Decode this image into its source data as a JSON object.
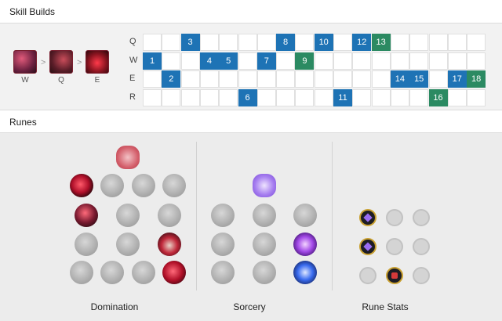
{
  "skill_section": {
    "title": "Skill Builds",
    "order": [
      {
        "key": "W",
        "icon": "skill-w-icon"
      },
      {
        "key": "Q",
        "icon": "skill-q-icon"
      },
      {
        "key": "E",
        "icon": "skill-e-icon"
      }
    ],
    "order_separator": ">",
    "rows": [
      {
        "key": "Q",
        "levels": [
          {
            "n": "3",
            "c": "blue"
          },
          {
            "n": "8",
            "c": "blue"
          },
          {
            "n": "10",
            "c": "blue"
          },
          {
            "n": "12",
            "c": "blue"
          },
          {
            "n": "13",
            "c": "green"
          }
        ]
      },
      {
        "key": "W",
        "levels": [
          {
            "n": "1",
            "c": "blue"
          },
          {
            "n": "4",
            "c": "blue"
          },
          {
            "n": "5",
            "c": "blue"
          },
          {
            "n": "7",
            "c": "blue"
          },
          {
            "n": "9",
            "c": "green"
          }
        ]
      },
      {
        "key": "E",
        "levels": [
          {
            "n": "2",
            "c": "blue"
          },
          {
            "n": "14",
            "c": "blue"
          },
          {
            "n": "15",
            "c": "blue"
          },
          {
            "n": "17",
            "c": "blue"
          },
          {
            "n": "18",
            "c": "green"
          }
        ]
      },
      {
        "key": "R",
        "levels": [
          {
            "n": "6",
            "c": "blue"
          },
          {
            "n": "11",
            "c": "blue"
          },
          {
            "n": "16",
            "c": "green"
          }
        ]
      }
    ],
    "colors": {
      "blue": "#1e73b5",
      "green": "#2b8a62"
    }
  },
  "runes_section": {
    "title": "Runes",
    "trees": [
      {
        "label": "Domination",
        "icon": "domination-tree-icon",
        "accent": "#c8283a"
      },
      {
        "label": "Sorcery",
        "icon": "sorcery-tree-icon",
        "accent": "#9a6cf2"
      },
      {
        "label": "Rune Stats",
        "icon": "",
        "accent": "#c9a030"
      }
    ]
  }
}
